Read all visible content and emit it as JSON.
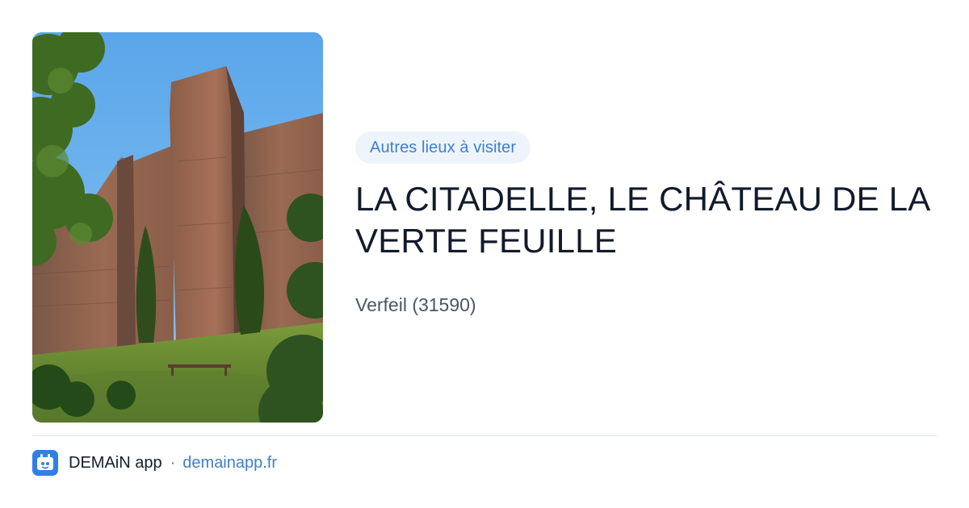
{
  "card": {
    "badge": "Autres lieux à visiter",
    "title": "LA CITADELLE, LE CHÂTEAU DE LA VERTE FEUILLE",
    "location": "Verfeil (31590)"
  },
  "footer": {
    "app_name": "DEMAiN app",
    "separator": "·",
    "domain": "demainapp.fr"
  },
  "colors": {
    "accent": "#3e7fcf",
    "badge_bg": "#eef4fc",
    "title": "#121a2b",
    "muted": "#4a5566",
    "app_icon_bg": "#2f7fe6"
  },
  "icons": {
    "app": "demain-app-icon",
    "photo": "castle-photo"
  }
}
